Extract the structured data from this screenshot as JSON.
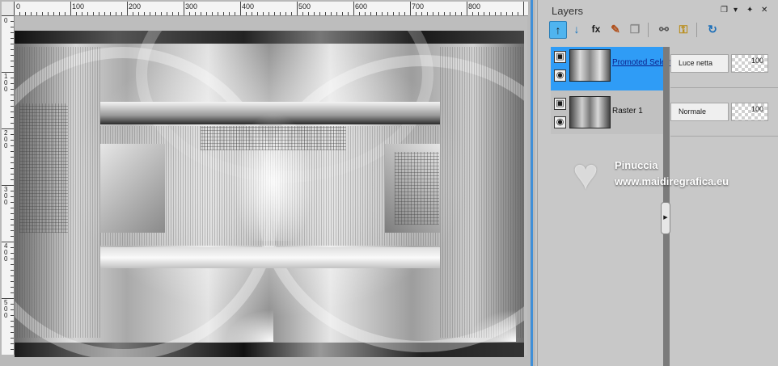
{
  "ruler": {
    "horizontal_labels": [
      "0",
      "100",
      "200",
      "300",
      "400",
      "500",
      "600",
      "700",
      "800"
    ],
    "vertical_labels": [
      "0",
      "1\n0\n0",
      "2\n0\n0",
      "3\n0\n0",
      "4\n0\n0",
      "5\n0\n0"
    ]
  },
  "layers_panel": {
    "title": "Layers",
    "controls": {
      "restore": "❐",
      "menu": "▾",
      "pin": "✦",
      "close": "✕"
    },
    "toolbar": [
      {
        "icon": "new-layer-icon",
        "glyph": "↑",
        "active": true
      },
      {
        "icon": "new-mask-icon",
        "glyph": "↓",
        "active": false
      },
      {
        "icon": "effects-icon",
        "glyph": "fx",
        "active": false
      },
      {
        "icon": "brush-icon",
        "glyph": "✎",
        "active": false
      },
      {
        "icon": "duplicate-icon",
        "glyph": "❐",
        "active": false
      },
      {
        "icon": "link-icon",
        "glyph": "⚯",
        "active": false
      },
      {
        "icon": "lock-icon",
        "glyph": "⚿",
        "active": false
      },
      {
        "icon": "properties-icon",
        "glyph": "↻",
        "active": false
      }
    ],
    "layers": [
      {
        "name": "Promoted Select",
        "blend_mode": "Luce netta",
        "opacity": "100",
        "selected": true,
        "visible": true
      },
      {
        "name": "Raster 1",
        "blend_mode": "Normale",
        "opacity": "100",
        "selected": false,
        "visible": true
      }
    ]
  },
  "watermark": {
    "name": "Pinuccia",
    "url": "www.maidiregrafica.eu"
  }
}
